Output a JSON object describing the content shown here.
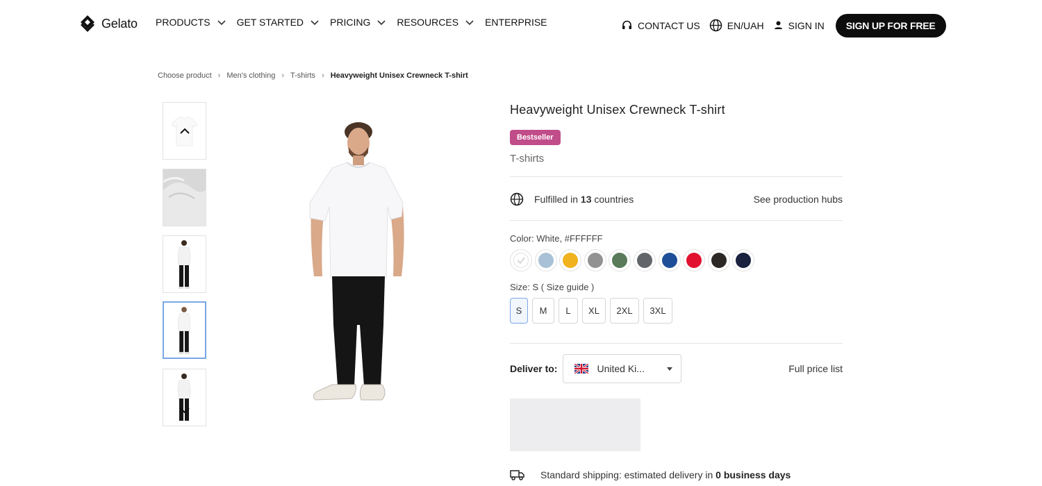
{
  "header": {
    "logo_text": "Gelato",
    "nav": [
      {
        "label": "PRODUCTS",
        "has_dropdown": true
      },
      {
        "label": "GET STARTED",
        "has_dropdown": true
      },
      {
        "label": "PRICING",
        "has_dropdown": true
      },
      {
        "label": "RESOURCES",
        "has_dropdown": true
      },
      {
        "label": "ENTERPRISE",
        "has_dropdown": false
      }
    ],
    "contact_label": "CONTACT US",
    "language_label": "EN/UAH",
    "signin_label": "SIGN IN",
    "signup_label": "SIGN UP FOR FREE"
  },
  "breadcrumb": {
    "items": [
      "Choose product",
      "Men's clothing",
      "T-shirts"
    ],
    "current": "Heavyweight Unisex Crewneck T-shirt"
  },
  "product": {
    "title": "Heavyweight Unisex Crewneck T-shirt",
    "badge": "Bestseller",
    "category": "T-shirts",
    "fulfilled_prefix": "Fulfilled in",
    "fulfilled_count": "13",
    "fulfilled_suffix": "countries",
    "production_hubs_link": "See production hubs",
    "color_label": "Color: White, #FFFFFF",
    "colors": [
      "#FFFFFF",
      "#A9C1D6",
      "#F0B21E",
      "#929292",
      "#5A7A5A",
      "#62656A",
      "#1E4E98",
      "#E1122F",
      "#2B2725",
      "#1A2240"
    ],
    "selected_color_index": 0,
    "size_label": "Size: S ( Size guide )",
    "sizes": [
      "S",
      "M",
      "L",
      "XL",
      "2XL",
      "3XL"
    ],
    "selected_size": "S",
    "deliver_label": "Deliver to:",
    "country": "United Ki...",
    "price_list_link": "Full price list",
    "shipping_prefix": "Standard shipping: estimated delivery in",
    "shipping_bold": "0 business days"
  },
  "thumbnails": [
    "tshirt-front-flat",
    "tshirt-fabric-detail",
    "model-back-view",
    "model-front-view",
    "model-back-view-2"
  ],
  "active_thumbnail_index": 3,
  "colors": {
    "accent_badge": "#C14C8A",
    "selected_border": "#7AA6E6",
    "signup_bg": "#0D0D0D"
  }
}
